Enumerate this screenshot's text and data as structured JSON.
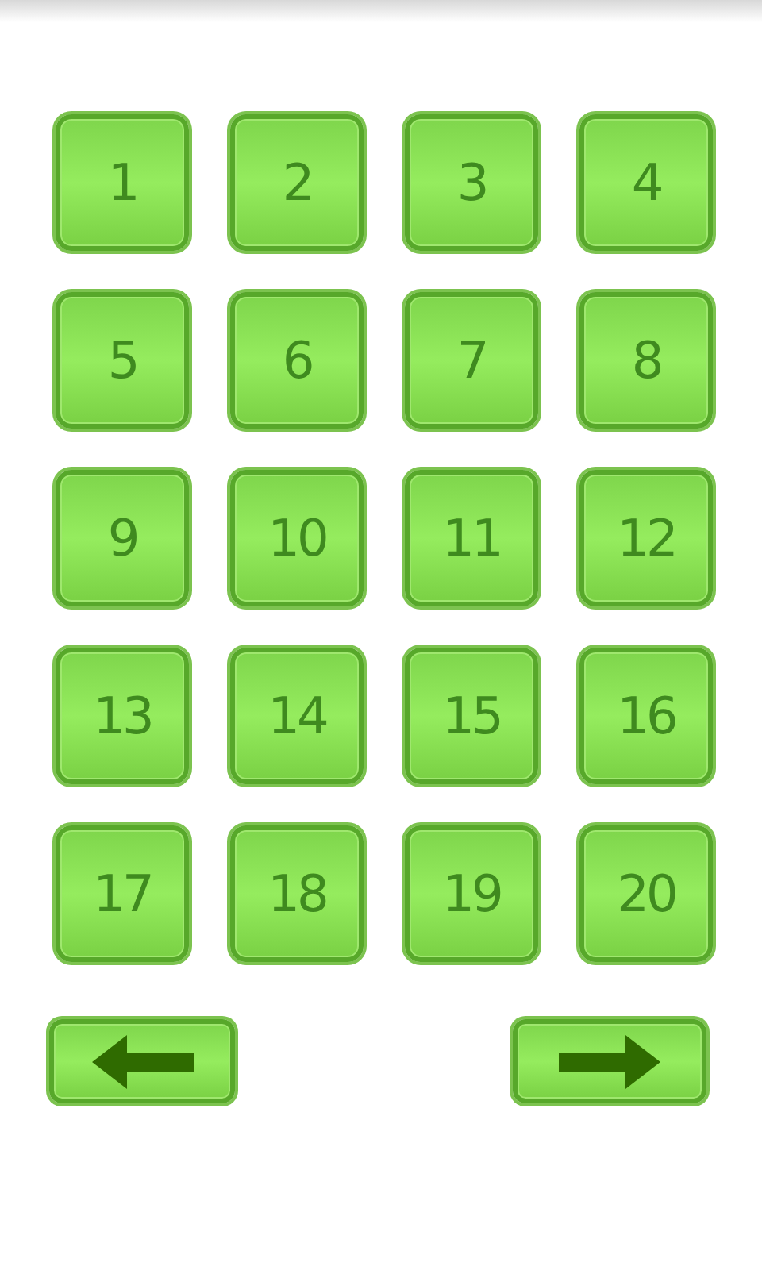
{
  "levels": [
    "1",
    "2",
    "3",
    "4",
    "5",
    "6",
    "7",
    "8",
    "9",
    "10",
    "11",
    "12",
    "13",
    "14",
    "15",
    "16",
    "17",
    "18",
    "19",
    "20"
  ]
}
